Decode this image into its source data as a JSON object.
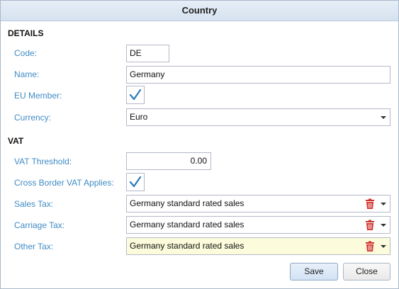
{
  "dialog": {
    "title": "Country"
  },
  "details": {
    "heading": "DETAILS",
    "code_label": "Code:",
    "code_value": "DE",
    "name_label": "Name:",
    "name_value": "Germany",
    "eu_label": "EU Member:",
    "eu_checked": true,
    "currency_label": "Currency:",
    "currency_value": "Euro"
  },
  "vat": {
    "heading": "VAT",
    "threshold_label": "VAT Threshold:",
    "threshold_value": "0.00",
    "cross_border_label": "Cross Border VAT Applies:",
    "cross_border_checked": true,
    "sales_tax_label": "Sales Tax:",
    "sales_tax_value": "Germany standard rated sales",
    "carriage_tax_label": "Carriage Tax:",
    "carriage_tax_value": "Germany standard rated sales",
    "other_tax_label": "Other Tax:",
    "other_tax_value": "Germany standard rated sales"
  },
  "buttons": {
    "save": "Save",
    "close": "Close"
  },
  "icons": {
    "check": "checkmark-icon",
    "delete": "trash-icon",
    "dropdown": "chevron-down-icon"
  },
  "colors": {
    "label": "#3f8bc4",
    "check": "#2a7bb8",
    "trash": "#d0302a",
    "highlight_field": "#fcfcdc",
    "titlebar": "#dde7f2"
  }
}
